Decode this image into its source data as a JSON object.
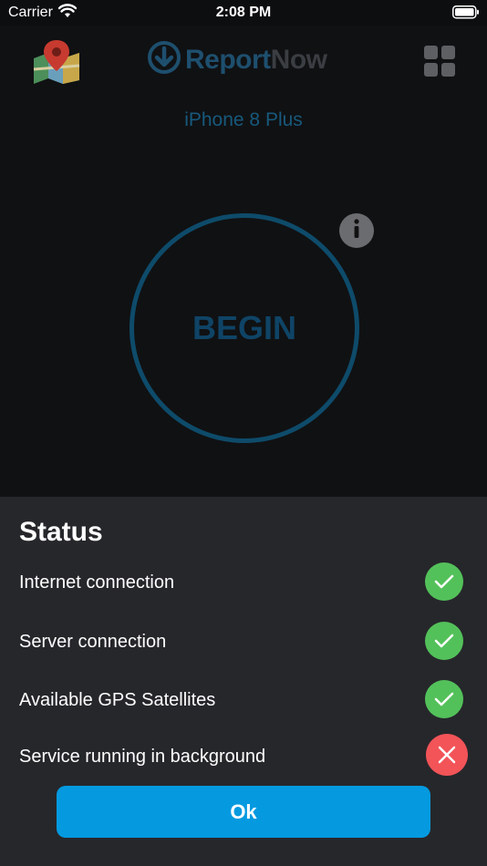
{
  "status_bar": {
    "carrier": "Carrier",
    "time": "2:08 PM"
  },
  "header": {
    "logo_part1": "Report",
    "logo_part2": "Now",
    "icons": {
      "left": "map-pin-icon",
      "right": "grid-menu-icon"
    }
  },
  "device_name": "iPhone 8 Plus",
  "begin_label": "BEGIN",
  "status_sheet": {
    "title": "Status",
    "items": [
      {
        "label": "Internet connection",
        "state": "ok"
      },
      {
        "label": "Server connection",
        "state": "ok"
      },
      {
        "label": "Available GPS Satellites",
        "state": "ok"
      },
      {
        "label": "Service running in background",
        "state": "error"
      }
    ],
    "ok_button_label": "Ok"
  },
  "colors": {
    "accent": "#059ae0",
    "success": "#53c15a",
    "error": "#f25458",
    "sheet_bg": "#26272b"
  }
}
